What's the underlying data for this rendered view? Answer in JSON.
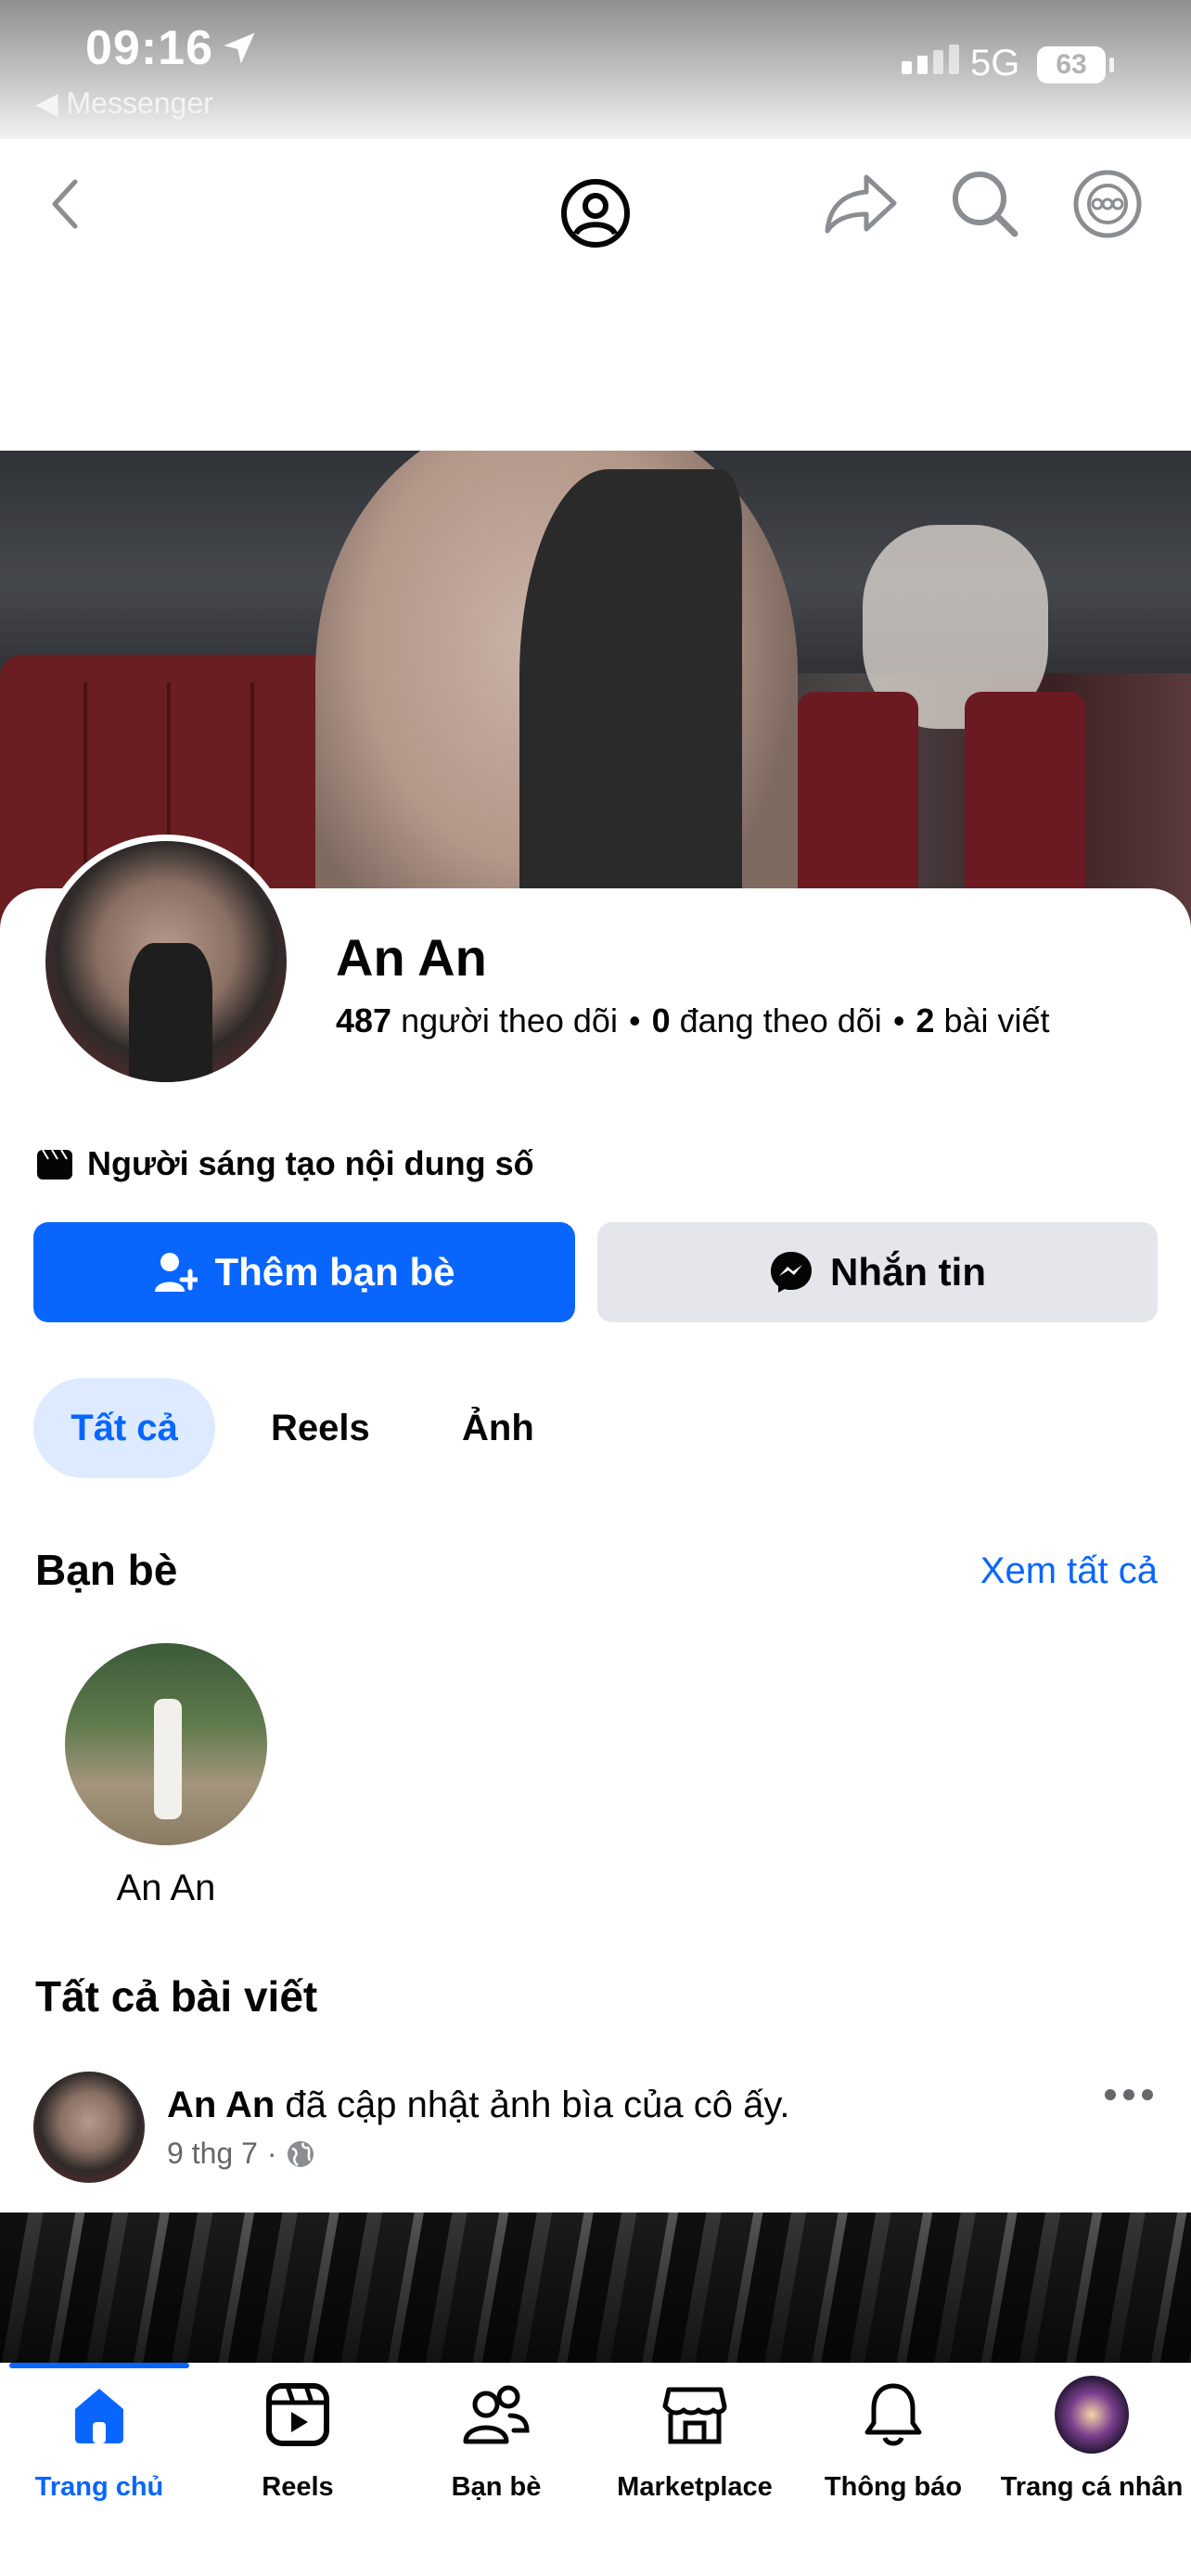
{
  "status_bar": {
    "time": "09:16",
    "back_app": "◀ Messenger",
    "network": "5G",
    "battery": "63"
  },
  "nav": {
    "icons": [
      "back-icon",
      "profile-icon",
      "share-icon",
      "search-icon",
      "more-icon"
    ]
  },
  "profile": {
    "name": "An An",
    "followers_count": "487",
    "followers_label": "người theo dõi",
    "following_count": "0",
    "following_label": "đang theo dõi",
    "posts_count": "2",
    "posts_label": "bài viết",
    "category": "Người sáng tạo nội dung số"
  },
  "actions": {
    "add_friend": "Thêm bạn bè",
    "message": "Nhắn tin"
  },
  "tabs": [
    {
      "label": "Tất cả",
      "active": true
    },
    {
      "label": "Reels",
      "active": false
    },
    {
      "label": "Ảnh",
      "active": false
    }
  ],
  "friends": {
    "title": "Bạn bè",
    "see_all": "Xem tất cả",
    "items": [
      {
        "name": "An An"
      }
    ]
  },
  "posts": {
    "title": "Tất cả bài viết",
    "items": [
      {
        "author": "An An",
        "action": "đã cập nhật ảnh bìa của cô ấy.",
        "date": "9 thg 7",
        "privacy": "public"
      }
    ]
  },
  "bottom_nav": [
    {
      "label": "Trang chủ",
      "icon": "home-icon",
      "active": true
    },
    {
      "label": "Reels",
      "icon": "reels-icon",
      "active": false
    },
    {
      "label": "Bạn bè",
      "icon": "friends-icon",
      "active": false
    },
    {
      "label": "Marketplace",
      "icon": "marketplace-icon",
      "active": false
    },
    {
      "label": "Thông báo",
      "icon": "bell-icon",
      "active": false
    },
    {
      "label": "Trang cá nhân",
      "icon": "avatar",
      "active": false
    }
  ],
  "colors": {
    "accent": "#0866ff",
    "secondary_button": "#e4e6eb",
    "active_tab_bg": "#ddeaff",
    "muted_text": "#65676b"
  }
}
